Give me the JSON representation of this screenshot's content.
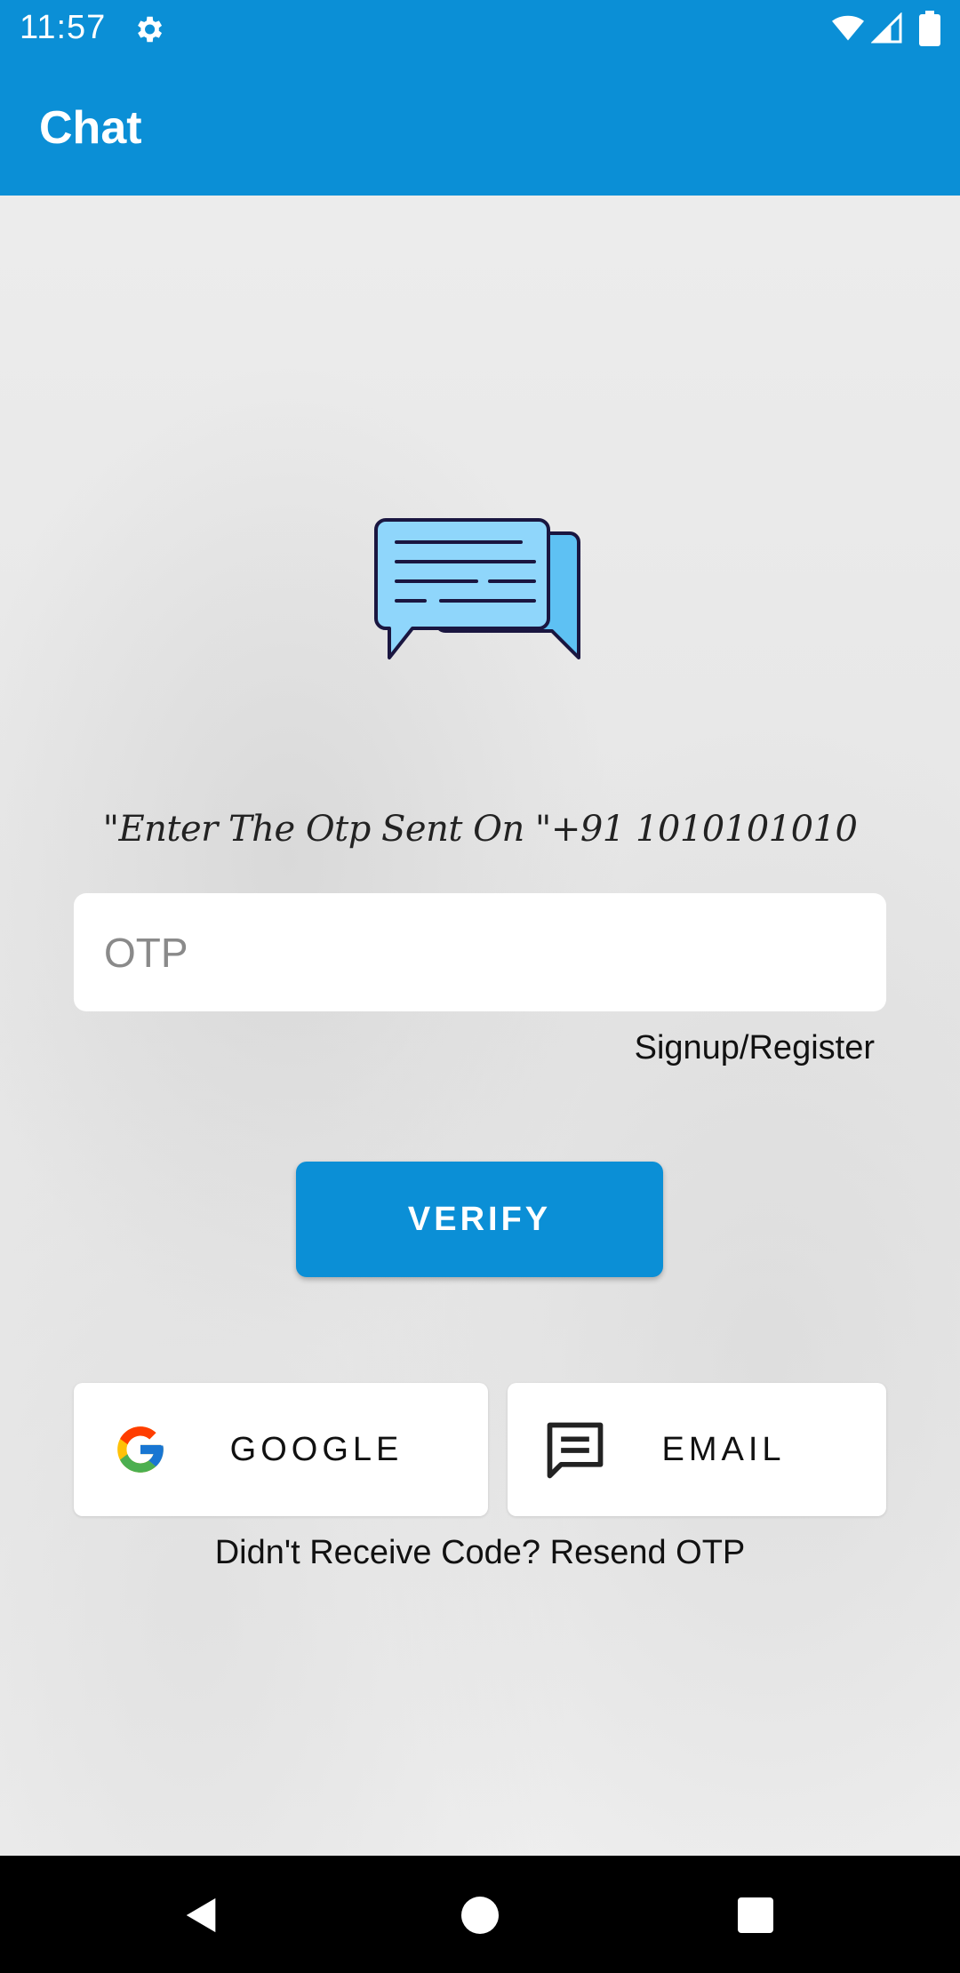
{
  "status_bar": {
    "time": "11:57",
    "icons": [
      "gear-icon",
      "wifi-icon",
      "signal-icon",
      "battery-icon"
    ]
  },
  "app_bar": {
    "title": "Chat",
    "color": "#0b8fd6"
  },
  "logo": {
    "icon": "chat-bubbles-icon"
  },
  "otp": {
    "prompt": "\"Enter The Otp Sent On \"+91 1010101010",
    "placeholder": "OTP",
    "value": ""
  },
  "links": {
    "signup": "Signup/Register",
    "resend": "Didn't Receive Code? Resend OTP"
  },
  "buttons": {
    "verify": "VERIFY",
    "google": "GOOGLE",
    "email": "EMAIL"
  },
  "nav_bar": {
    "icons": [
      "back-icon",
      "home-icon",
      "recents-icon"
    ]
  }
}
